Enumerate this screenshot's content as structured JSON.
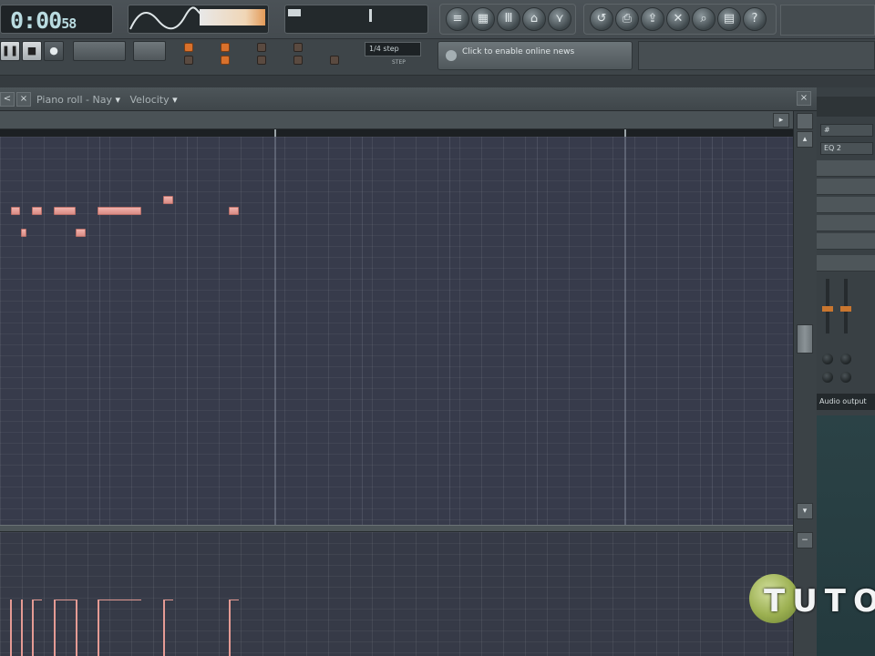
{
  "toolbar": {
    "time": "0:00",
    "time_small": "58",
    "snap_label": "1/4 step",
    "snap_sub": "STEP",
    "news_text": "Click to enable online news",
    "transport_icons": [
      "pause-icon",
      "stop-icon",
      "record-icon"
    ]
  },
  "piano_roll": {
    "title": "Piano roll - Nay",
    "target": "Velocity",
    "nav_prev": "<",
    "nav_close_icon": "×",
    "scroll_left": "◂",
    "scroll_right": "▸",
    "scroll_up": "▴",
    "scroll_down": "▾"
  },
  "side_panel": {
    "field_1": "#",
    "field_2": "EQ 2",
    "audio_label": "Audio output"
  },
  "watermark": {
    "text": "TUTO"
  },
  "colors": {
    "note": "#e59b94",
    "grid_bg": "#373b4b",
    "accent_orange": "#d9712c"
  }
}
